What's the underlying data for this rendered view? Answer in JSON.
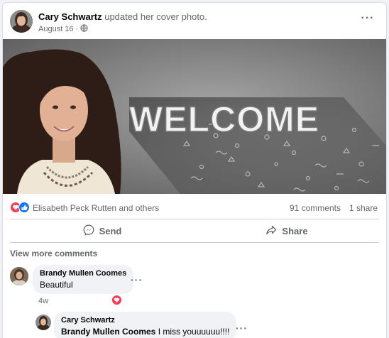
{
  "post": {
    "author": "Cary Schwartz",
    "action": "updated her cover photo.",
    "date": "August 16",
    "more_label": "···"
  },
  "cover": {
    "headline": "WELCOME"
  },
  "reactions": {
    "names": "Elisabeth Peck Rutten and others",
    "comments": "91 comments",
    "shares": "1 share"
  },
  "actions": {
    "send_label": "Send",
    "share_label": "Share"
  },
  "comments": {
    "view_more": "View more comments",
    "items": [
      {
        "author": "Brandy Mullen Coomes",
        "text": "Beautiful",
        "time": "4w"
      },
      {
        "author": "Cary Schwartz",
        "mention": "Brandy Mullen Coomes",
        "text": " I miss youuuuuu!!!!"
      }
    ]
  },
  "colors": {
    "like_blue": "#1877f2",
    "love_red": "#f33e58",
    "secondary_text": "#65676b"
  }
}
